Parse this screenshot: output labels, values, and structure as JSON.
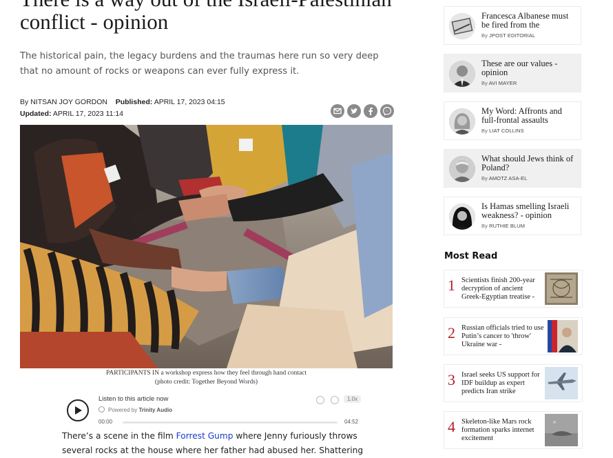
{
  "article": {
    "title_line1": "There is a way out of the Israeli-Palestinian",
    "title_line2": "conflict - opinion",
    "subtitle": "The historical pain, the legacy burdens and the traumas here run so very deep that no amount of rocks or weapons can ever fully express it.",
    "byline_prefix": "By",
    "author": "NITSAN JOY GORDON",
    "published_label": "Published:",
    "published_date": "APRIL 17, 2023 04:15",
    "updated_label": "Updated:",
    "updated_date": "APRIL 17, 2023 11:14",
    "caption_line1": "PARTICIPANTS IN a workshop express how they feel through hand contact",
    "caption_line2": "(photo credit: Together Beyond Words)",
    "body_before_link": "There’s a scene in the film ",
    "body_link": "Forrest Gump",
    "body_after_link": " where Jenny furiously throws several rocks at the house where her father had abused her. Shattering the"
  },
  "share_icons": [
    "email-icon",
    "twitter-icon",
    "facebook-icon",
    "messenger-icon"
  ],
  "audio_player": {
    "listen_label": "Listen to this article now",
    "powered_prefix": "Powered by",
    "powered_brand": "Trinity Audio",
    "speed": "1.0x",
    "time_current": "00:00",
    "time_total": "04:52",
    "progress": 0
  },
  "sidebar": {
    "opinion_items": [
      {
        "title": "Francesca Albanese must be fired from the",
        "by": "By",
        "author": "JPOST EDITORIAL"
      },
      {
        "title": "These are our values - opinion",
        "by": "By",
        "author": "AVI MAYER"
      },
      {
        "title": "My Word: Affronts and full-frontal assaults",
        "by": "By",
        "author": "LIAT COLLINS"
      },
      {
        "title": "What should Jews think of Poland?",
        "by": "By",
        "author": "AMOTZ ASA-EL"
      },
      {
        "title": "Is Hamas smelling Israeli weakness? - opinion",
        "by": "By",
        "author": "RUTHIE BLUM"
      }
    ],
    "most_read_heading": "Most Read",
    "most_read": [
      {
        "rank": "1",
        "title": "Scientists finish 200-year decryption of ancient Greek-Egyptian treatise -"
      },
      {
        "rank": "2",
        "title": "Russian officials tried to use Putin’s cancer to 'throw' Ukraine war -"
      },
      {
        "rank": "3",
        "title": "Israel seeks US support for IDF buildup as expert predicts Iran strike"
      },
      {
        "rank": "4",
        "title": "Skeleton-like Mars rock formation sparks internet excitement"
      }
    ]
  },
  "colors": {
    "rank_red": "#b31b2a",
    "link_blue": "#1a3bc8",
    "share_grey": "#8a8a8a"
  }
}
